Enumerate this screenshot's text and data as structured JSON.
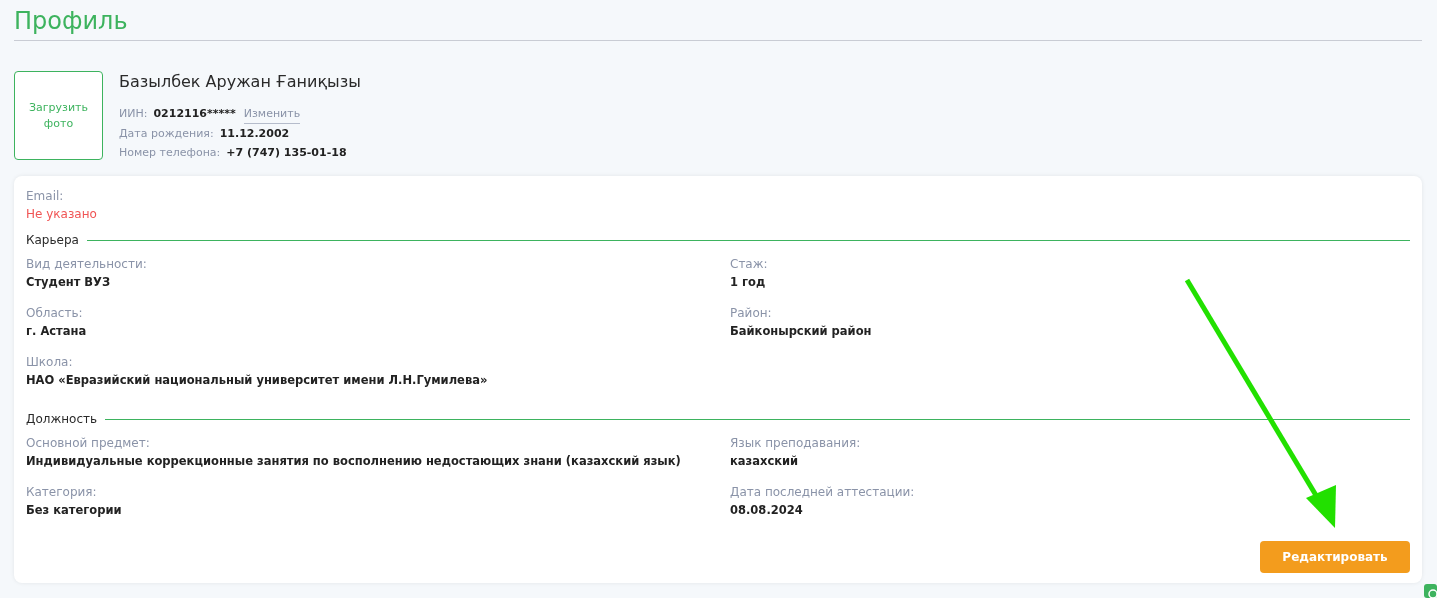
{
  "page": {
    "title": "Профиль"
  },
  "profile": {
    "photo_label": "Загрузить фото",
    "name": "Базылбек Аружан Ғаниқызы",
    "details": [
      {
        "label": "ИИН:",
        "value": "0212116*****",
        "link": "Изменить"
      },
      {
        "label": "Дата рождения:",
        "value": "11.12.2002"
      },
      {
        "label": "Номер телефона:",
        "value": "+7 (747) 135-01-18"
      }
    ]
  },
  "email": {
    "label": "Email:",
    "value": "Не указано",
    "missing": true
  },
  "sections": [
    {
      "title": "Карьера",
      "fields": [
        {
          "label": "Вид деятельности:",
          "value": "Студент ВУЗ"
        },
        {
          "label": "Стаж:",
          "value": "1 год"
        },
        {
          "label": "Область:",
          "value": "г. Астана"
        },
        {
          "label": "Район:",
          "value": "Байконырский район"
        },
        {
          "label": "Школа:",
          "value": "НАО «Евразийский национальный университет имени Л.Н.Гумилева»"
        }
      ]
    },
    {
      "title": "Должность",
      "fields": [
        {
          "label": "Основной предмет:",
          "value": "Индивидуальные коррекционные занятия по восполнению недостающих знани (казахский язык)"
        },
        {
          "label": "Язык преподавания:",
          "value": "казахский"
        },
        {
          "label": "Категория:",
          "value": "Без категории"
        },
        {
          "label": "Дата последней аттестации:",
          "value": "08.08.2024"
        }
      ]
    }
  ],
  "edit_button": {
    "label": "Редактировать"
  }
}
